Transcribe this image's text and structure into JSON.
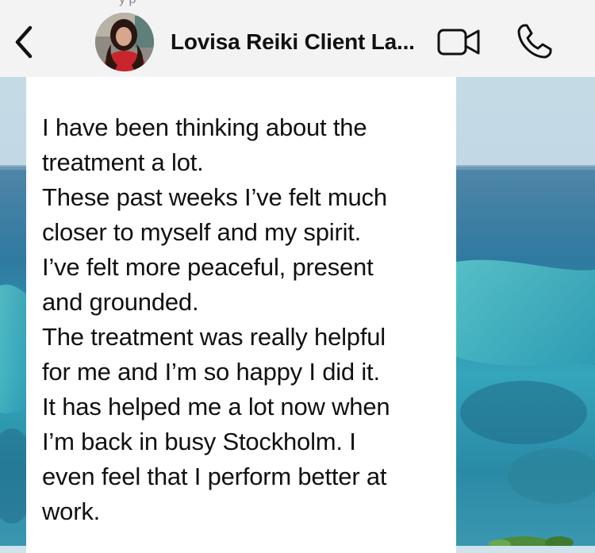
{
  "header": {
    "status_fragment": "y  p",
    "contact_name": "Lovisa Reiki Client  La...",
    "back_icon": "chevron-left-icon",
    "video_icon": "video-camera-icon",
    "call_icon": "phone-icon"
  },
  "message": {
    "lines": [
      "I have been thinking about the",
      "treatment a lot.",
      "These past weeks I’ve felt much",
      "closer to myself and my spirit.",
      "I’ve felt more peaceful, present",
      "and grounded.",
      "The treatment was really helpful",
      "for me and I’m so happy I did it.",
      "It has helped me a lot now when",
      "I’m back in busy Stockholm. I",
      "even feel that I perform better at",
      "work."
    ]
  },
  "colors": {
    "header_bg": "#f3f3f4",
    "bubble_bg": "#ffffff",
    "text": "#111111",
    "sea_dark": "#2f6f93",
    "sea_turquoise": "#3fb2c2",
    "sky": "#cfe3ec"
  }
}
